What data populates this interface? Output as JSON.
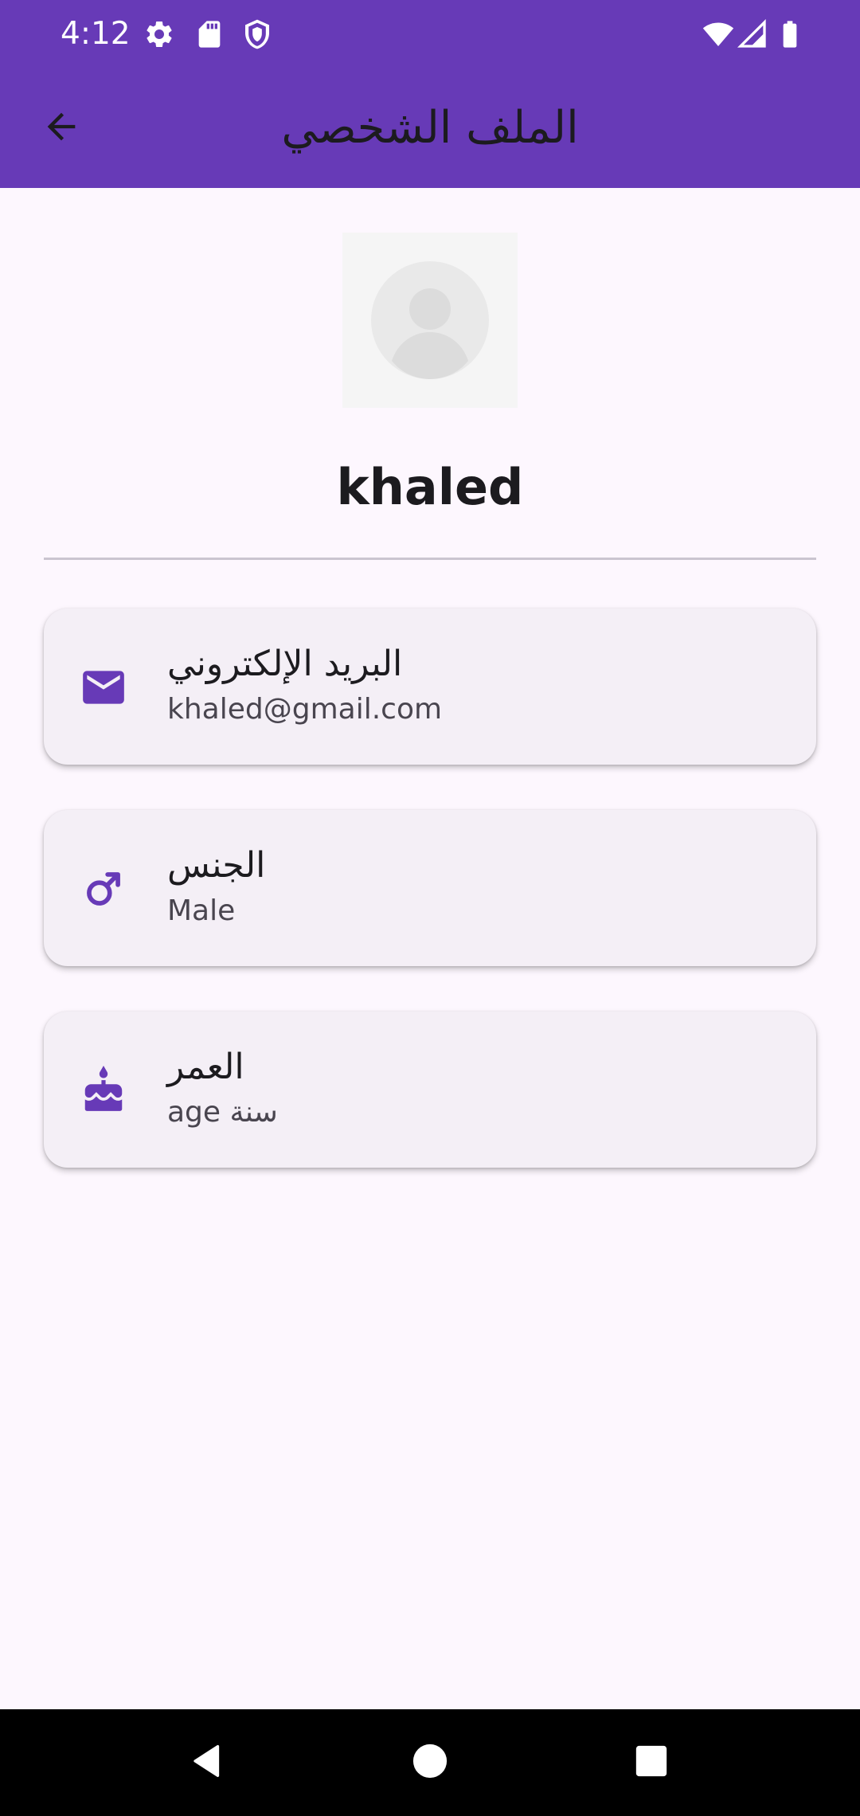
{
  "status_bar": {
    "time": "4:12",
    "left_icons": [
      "gear-icon",
      "sd-card-icon",
      "shield-icon"
    ],
    "right_icons": [
      "wifi-icon",
      "cellular-signal-icon",
      "battery-icon"
    ]
  },
  "app_bar": {
    "title": "الملف الشخصي",
    "back_icon": "arrow-back-icon",
    "background": "#673AB7"
  },
  "profile": {
    "avatar_icon": "person-placeholder-icon",
    "name": "khaled"
  },
  "cards": [
    {
      "icon": "email-icon",
      "title": "البريد الإلكتروني",
      "value": "khaled@gmail.com"
    },
    {
      "icon": "male-icon",
      "title": "الجنس",
      "value": "Male"
    },
    {
      "icon": "cake-icon",
      "title": "العمر",
      "value": "age سنة"
    }
  ],
  "colors": {
    "primary": "#673AB7",
    "background": "#FDF7FE",
    "card": "#F4EFF6"
  },
  "nav_bar": {
    "buttons": [
      "back-triangle-icon",
      "home-circle-icon",
      "recents-square-icon"
    ]
  }
}
